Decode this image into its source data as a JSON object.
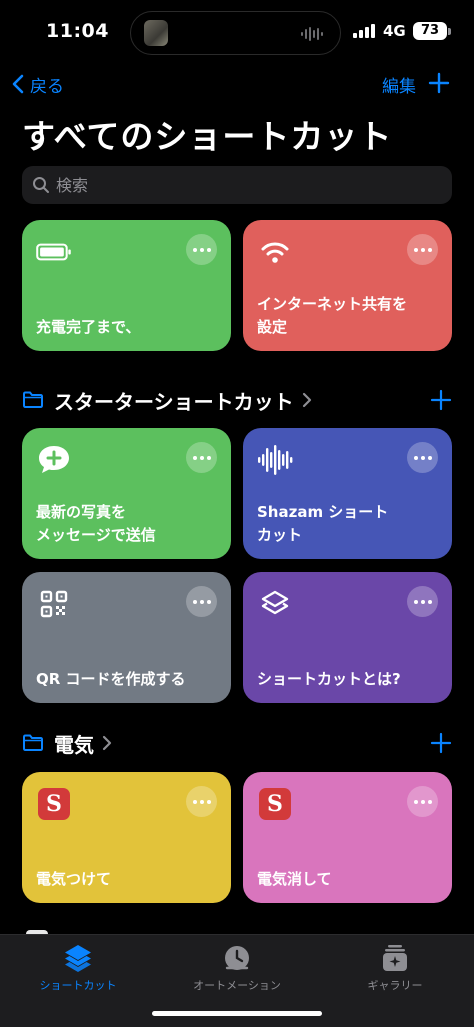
{
  "status_bar": {
    "time": "11:04",
    "network": "4G",
    "battery": "73"
  },
  "nav": {
    "back_label": "戻る",
    "edit_label": "編集"
  },
  "page": {
    "title": "すべてのショートカット"
  },
  "search": {
    "placeholder": "検索"
  },
  "top_cards": [
    {
      "label": "充電完了まで、",
      "icon": "battery-icon",
      "color": "#5cc05e"
    },
    {
      "label": "インターネット共有を\n設定",
      "icon": "wifi-icon",
      "color": "#e0605c"
    }
  ],
  "folders": [
    {
      "name": "スターターショートカット",
      "cards": [
        {
          "label": "最新の写真を\nメッセージで送信",
          "icon": "message-plus-icon",
          "color": "#5cc05e"
        },
        {
          "label": "Shazam ショート\nカット",
          "icon": "waveform-icon",
          "color": "#4656b6"
        },
        {
          "label": "QR コードを作成する",
          "icon": "qr-code-icon",
          "color": "#727a84"
        },
        {
          "label": "ショートカットとは?",
          "icon": "shortcuts-layers-icon",
          "color": "#6a47a8"
        }
      ]
    },
    {
      "name": "電気",
      "cards": [
        {
          "label": "電気つけて",
          "icon": "s-app-icon",
          "badge": "S",
          "color": "#e2c33a"
        },
        {
          "label": "電気消して",
          "icon": "s-app-icon",
          "badge": "S",
          "color": "#d975bd"
        }
      ]
    }
  ],
  "tab_bar": {
    "tabs": [
      {
        "label": "ショートカット",
        "icon": "shortcuts-layers-icon",
        "active": true
      },
      {
        "label": "オートメーション",
        "icon": "clock-check-icon",
        "active": false
      },
      {
        "label": "ギャラリー",
        "icon": "gallery-icon",
        "active": false
      }
    ]
  },
  "colors": {
    "accent": "#0a84ff",
    "background": "#000000"
  }
}
